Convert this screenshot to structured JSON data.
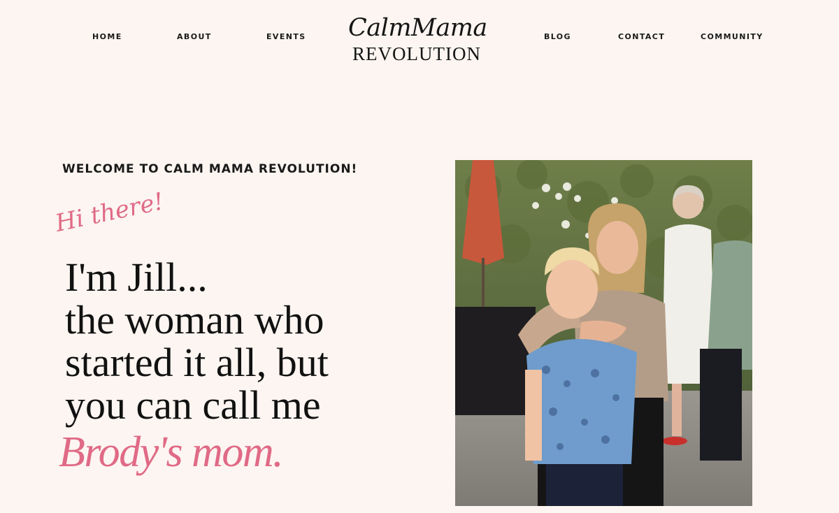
{
  "nav": {
    "left": [
      {
        "label": "HOME"
      },
      {
        "label": "ABOUT"
      },
      {
        "label": "EVENTS"
      }
    ],
    "right": [
      {
        "label": "BLOG"
      },
      {
        "label": "CONTACT"
      },
      {
        "label": "COMMUNITY"
      }
    ]
  },
  "logo": {
    "script": "CalmMama",
    "sub": "REVOLUTION"
  },
  "hero": {
    "welcome": "WELCOME TO CALM MAMA REVOLUTION!",
    "greeting": "Hi there!",
    "lines": [
      "I'm Jill...",
      "the woman who",
      "started it all, but",
      "you can call me"
    ],
    "highlight": "Brody's mom."
  },
  "colors": {
    "background": "#fcf5f1",
    "accent": "#e06a86",
    "text": "#1a1a1a"
  }
}
